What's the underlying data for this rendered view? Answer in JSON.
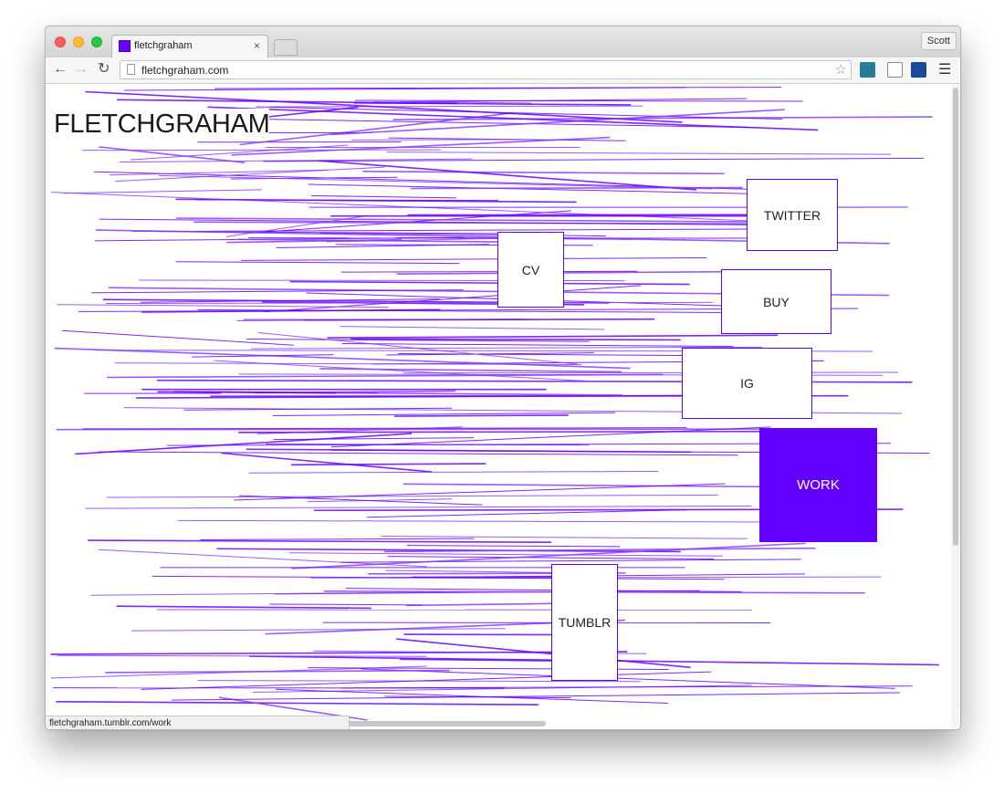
{
  "browser": {
    "tab_title": "fletchgraham",
    "tab_close": "×",
    "profile_name": "Scott",
    "url": "fletchgraham.com",
    "status_url": "fletchgraham.tumblr.com/work",
    "icons": {
      "back": "back-arrow-icon",
      "forward": "forward-arrow-icon",
      "reload": "reload-icon",
      "star": "bookmark-star-icon",
      "menu": "hamburger-menu-icon"
    }
  },
  "page": {
    "title": "FLETCHGRAHAM",
    "accent_color": "#6200ff",
    "links": {
      "twitter": "TWITTER",
      "cv": "CV",
      "buy": "BUY",
      "ig": "IG",
      "work": "WORK",
      "tumblr": "TUMBLR"
    }
  }
}
